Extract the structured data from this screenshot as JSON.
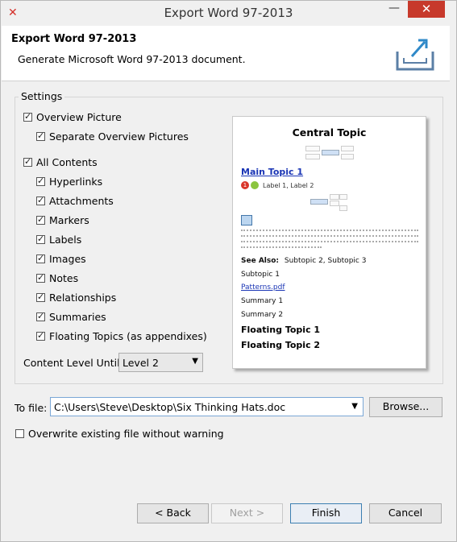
{
  "window": {
    "title": "Export Word 97-2013"
  },
  "header": {
    "title": "Export Word 97-2013",
    "description": "Generate Microsoft Word 97-2013 document."
  },
  "settings": {
    "label": "Settings",
    "overview_picture": {
      "label": "Overview Picture",
      "checked": true
    },
    "separate_overview": {
      "label": "Separate Overview Pictures",
      "checked": true
    },
    "all_contents": {
      "label": "All Contents",
      "checked": true
    },
    "items": [
      {
        "label": "Hyperlinks",
        "checked": true
      },
      {
        "label": "Attachments",
        "checked": true
      },
      {
        "label": "Markers",
        "checked": true
      },
      {
        "label": "Labels",
        "checked": true
      },
      {
        "label": "Images",
        "checked": true
      },
      {
        "label": "Notes",
        "checked": true
      },
      {
        "label": "Relationships",
        "checked": true
      },
      {
        "label": "Summaries",
        "checked": true
      },
      {
        "label": "Floating Topics (as appendixes)",
        "checked": true
      }
    ],
    "content_level_label": "Content Level Until:",
    "content_level_value": "Level 2"
  },
  "preview": {
    "central_topic": "Central Topic",
    "main_topic": "Main Topic 1",
    "marker_priority": "1",
    "labels_text": "Label 1, Label 2",
    "see_also_label": "See Also:",
    "see_also_value": "Subtopic 2, Subtopic 3",
    "subtopic": "Subtopic 1",
    "attachment": "Patterns.pdf",
    "summary1": "Summary 1",
    "summary2": "Summary 2",
    "floating1": "Floating Topic 1",
    "floating2": "Floating Topic 2"
  },
  "file": {
    "label": "To file:",
    "value": "C:\\Users\\Steve\\Desktop\\Six Thinking Hats.doc",
    "browse_label": "Browse...",
    "overwrite_label": "Overwrite existing file without warning",
    "overwrite_checked": false
  },
  "buttons": {
    "back": "< Back",
    "next": "Next >",
    "finish": "Finish",
    "cancel": "Cancel"
  },
  "colors": {
    "close": "#c7392b",
    "link": "#1a35b5",
    "accent": "#3c7fb1"
  }
}
